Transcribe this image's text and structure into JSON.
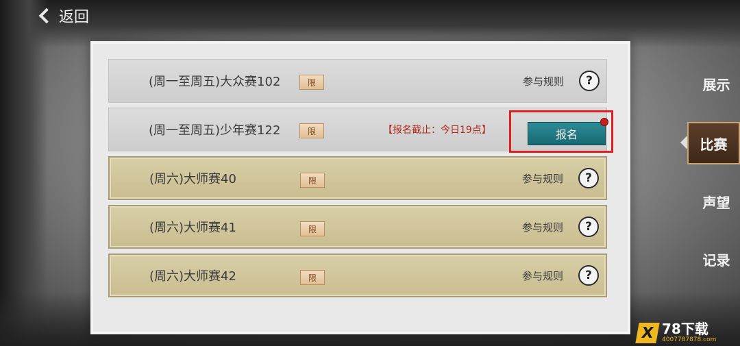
{
  "header": {
    "back_label": "返回"
  },
  "rows": [
    {
      "title": "(周一至周五)大众赛102",
      "badge": "限",
      "rules_label": "参与规则",
      "help": "?"
    },
    {
      "title": "(周一至周五)少年赛122",
      "badge": "限",
      "deadline": "【报名截止：今日19点】",
      "signup_label": "报名"
    },
    {
      "title": "(周六)大师赛40",
      "badge": "限",
      "rules_label": "参与规则",
      "help": "?"
    },
    {
      "title": "(周六)大师赛41",
      "badge": "限",
      "rules_label": "参与规则",
      "help": "?"
    },
    {
      "title": "(周六)大师赛42",
      "badge": "限",
      "rules_label": "参与规则",
      "help": "?"
    }
  ],
  "side_tabs": [
    {
      "label": "展示",
      "active": false
    },
    {
      "label": "比赛",
      "active": true
    },
    {
      "label": "声望",
      "active": false
    },
    {
      "label": "记录",
      "active": false
    }
  ],
  "watermark": {
    "logo": "X",
    "title": "78下载",
    "subtitle": "4007787878.com"
  },
  "colors": {
    "signup_button": "#176973",
    "deadline_text": "#b02a1c",
    "highlight_border": "#e02020",
    "tan_row": "#c9bc8f"
  },
  "icons": {
    "back": "chevron-left-icon",
    "help": "question-circle-icon",
    "notify": "red-dot-icon"
  }
}
